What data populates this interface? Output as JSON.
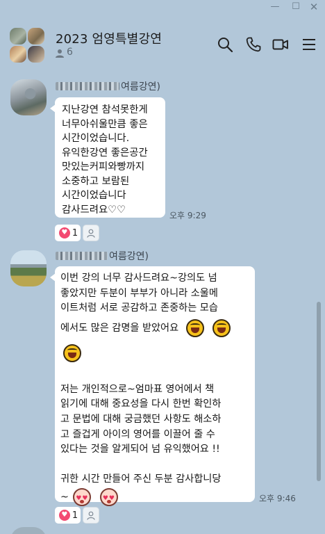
{
  "window": {
    "min_glyph": "—",
    "max_glyph": "☐",
    "close_glyph": "✕"
  },
  "header": {
    "title": "2023 엄영특별강연",
    "member_count": "6",
    "icons": [
      "search-icon",
      "phone-icon",
      "video-icon",
      "menu-icon"
    ]
  },
  "messages": [
    {
      "sender_suffix": "여름강연)",
      "lines": [
        "지난강연 참석못한게",
        "너무아쉬울만큼 좋은",
        "시간이었습니다.",
        "유익한강연 좋은공간",
        "맛있는커피와빵까지",
        "소중하고 보람된",
        "시간이었습니다",
        "감사드려요♡♡"
      ],
      "time": "오후 9:29",
      "reaction_count": "1"
    },
    {
      "sender_suffix": "여름강연)",
      "lines_a": [
        "이번 강의  너무 감사드려요~강의도  넘",
        " 좋았지만 두분이 부부가 아니라 소울메",
        "이트처럼 서로 공감하고 존중하는 모습",
        "에서도 많은 감명을 받았어요"
      ],
      "lines_b": [
        "저는 개인적으로~엄마표 영어에서  책",
        "읽기에 대해 중요성을 다시 한번 확인하",
        "고 문법에 대해 궁금했던 사항도 해소하",
        "고 즐겁게 아이의 영어를 이끌어 줄 수",
        "있다는 것을 알게되어 넘 유익했어요 !!"
      ],
      "lines_c": [
        "귀한 시간 만들어 주신 두분 감사합니당"
      ],
      "tilde": "~",
      "time": "오후 9:46",
      "reaction_count": "1"
    }
  ],
  "colors": {
    "background": "#b2c7d9",
    "bubble": "#ffffff",
    "heart_badge": "#f34a72"
  }
}
